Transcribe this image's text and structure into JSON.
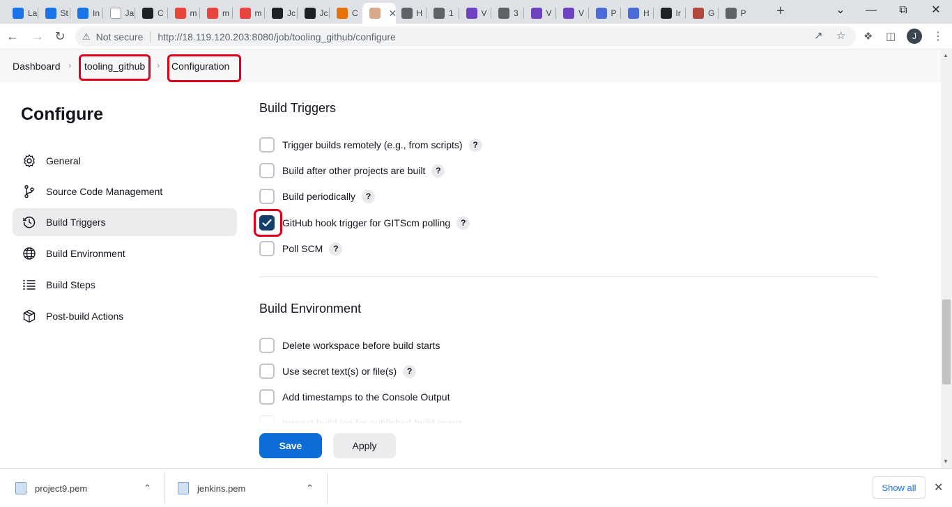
{
  "browser": {
    "tabs": [
      {
        "title": "La",
        "color": "#1a73e8"
      },
      {
        "title": "St",
        "color": "#1a73e8"
      },
      {
        "title": "In",
        "color": "#1a73e8"
      },
      {
        "title": "Ja",
        "color": "#ffffff"
      },
      {
        "title": "C",
        "color": "#202124"
      },
      {
        "title": "m",
        "color": "#e8453c"
      },
      {
        "title": "m",
        "color": "#e8453c"
      },
      {
        "title": "m",
        "color": "#e8453c"
      },
      {
        "title": "Jc",
        "color": "#202124"
      },
      {
        "title": "Jc",
        "color": "#202124"
      },
      {
        "title": "C",
        "color": "#e8710a"
      },
      {
        "title": "",
        "color": "#d9a98c",
        "active": true
      },
      {
        "title": "H",
        "color": "#5f6368"
      },
      {
        "title": "1",
        "color": "#5f6368"
      },
      {
        "title": "V",
        "color": "#6f42c1"
      },
      {
        "title": "3",
        "color": "#5f6368"
      },
      {
        "title": "V",
        "color": "#6f42c1"
      },
      {
        "title": "V",
        "color": "#6f42c1"
      },
      {
        "title": "P",
        "color": "#4a6cd4"
      },
      {
        "title": "H",
        "color": "#4a6cd4"
      },
      {
        "title": "Ir",
        "color": "#202124"
      },
      {
        "title": "G",
        "color": "#b0483c"
      },
      {
        "title": "P",
        "color": "#5f6368"
      }
    ],
    "security_label": "Not secure",
    "url": "http://18.119.120.203:8080/job/tooling_github/configure",
    "profile_initial": "J"
  },
  "breadcrumb": {
    "items": [
      "Dashboard",
      "tooling_github",
      "Configuration"
    ]
  },
  "sidebar": {
    "title": "Configure",
    "items": [
      {
        "label": "General",
        "icon": "gear-icon"
      },
      {
        "label": "Source Code Management",
        "icon": "branch-icon"
      },
      {
        "label": "Build Triggers",
        "icon": "clock-icon",
        "active": true
      },
      {
        "label": "Build Environment",
        "icon": "globe-icon"
      },
      {
        "label": "Build Steps",
        "icon": "list-icon"
      },
      {
        "label": "Post-build Actions",
        "icon": "package-icon"
      }
    ]
  },
  "build_triggers": {
    "title": "Build Triggers",
    "options": [
      {
        "label": "Trigger builds remotely (e.g., from scripts)",
        "checked": false,
        "help": true
      },
      {
        "label": "Build after other projects are built",
        "checked": false,
        "help": true
      },
      {
        "label": "Build periodically",
        "checked": false,
        "help": true
      },
      {
        "label": "GitHub hook trigger for GITScm polling",
        "checked": true,
        "help": true
      },
      {
        "label": "Poll SCM",
        "checked": false,
        "help": true
      }
    ]
  },
  "build_environment": {
    "title": "Build Environment",
    "options": [
      {
        "label": "Delete workspace before build starts",
        "checked": false,
        "help": false
      },
      {
        "label": "Use secret text(s) or file(s)",
        "checked": false,
        "help": true
      },
      {
        "label": "Add timestamps to the Console Output",
        "checked": false,
        "help": false
      },
      {
        "label": "Inspect build log for published build scans",
        "checked": false,
        "help": false
      }
    ]
  },
  "actions": {
    "save_label": "Save",
    "apply_label": "Apply"
  },
  "help_glyph": "?",
  "downloads": {
    "items": [
      "project9.pem",
      "jenkins.pem"
    ],
    "show_all_label": "Show all"
  },
  "colors": {
    "primary_button": "#0b6cd6",
    "checkbox_checked": "#143e6b",
    "annotation_red": "#e0001a"
  }
}
